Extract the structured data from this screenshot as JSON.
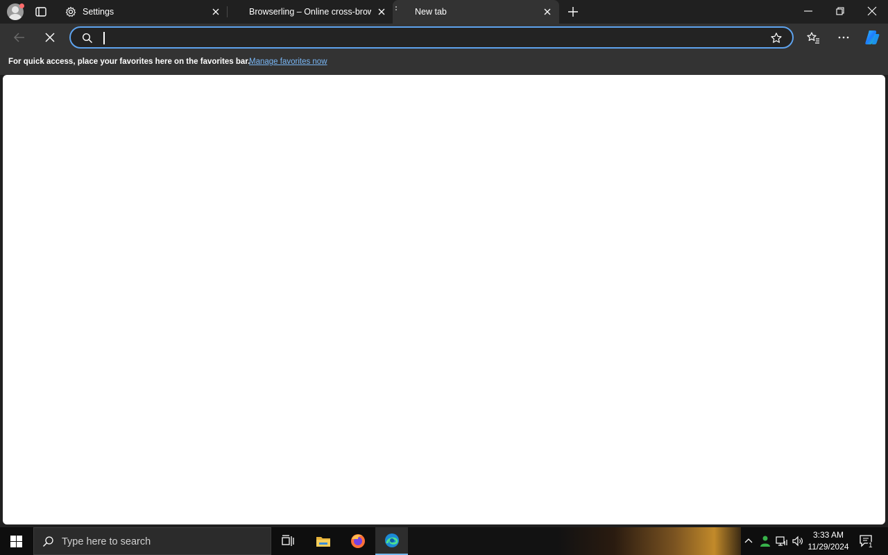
{
  "browser": {
    "tabs": [
      {
        "title": "Settings",
        "icon": "gear-icon"
      },
      {
        "title": "Browserling – Online cross-brows",
        "icon": "browserling-icon"
      },
      {
        "title": "New tab",
        "icon": "newtab-icon",
        "active": true
      }
    ],
    "address": {
      "value": "",
      "placeholder": ""
    },
    "favorites_bar": {
      "message": "For quick access, place your favorites here on the favorites bar.",
      "link": "Manage favorites now"
    },
    "colors": {
      "accent": "#5ea3ee",
      "link": "#7ab7f5",
      "chrome": "#333333",
      "titlebar": "#202020"
    }
  },
  "taskbar": {
    "search_placeholder": "Type here to search",
    "apps": [
      "task-view",
      "file-explorer",
      "firefox",
      "edge"
    ],
    "clock": {
      "time": "3:33 AM",
      "date": "11/29/2024"
    },
    "notifications": "1"
  }
}
